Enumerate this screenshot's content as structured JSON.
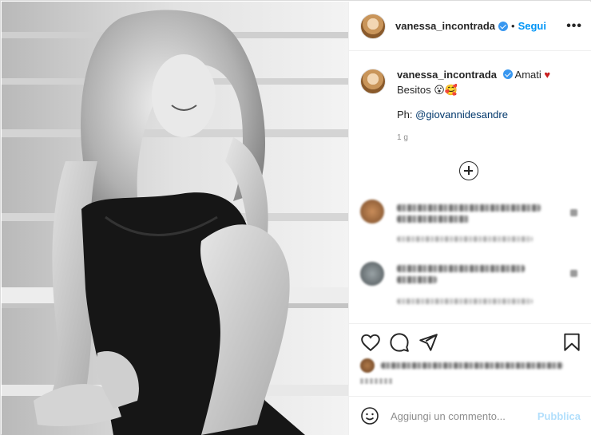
{
  "post": {
    "username": "vanessa_incontrada",
    "follow_label": "Segui",
    "separator": "•",
    "more_label": "•••"
  },
  "caption": {
    "username": "vanessa_incontrada",
    "text_1": "Amati",
    "heart": "♥",
    "text_2": "Besitos 😮🥰",
    "ph_prefix": "Ph: ",
    "mention": "@giovannidesandre",
    "time": "1 g"
  },
  "actions": {
    "like_icon": "heart-outline-icon",
    "comment_icon": "comment-bubble-icon",
    "share_icon": "paper-plane-icon",
    "save_icon": "bookmark-icon"
  },
  "add_comment": {
    "placeholder": "Aggiungi un commento...",
    "publish_label": "Pubblica"
  },
  "colors": {
    "accent": "#0095f6",
    "publish_disabled": "#b2dffc",
    "heart": "#c81e1e"
  }
}
